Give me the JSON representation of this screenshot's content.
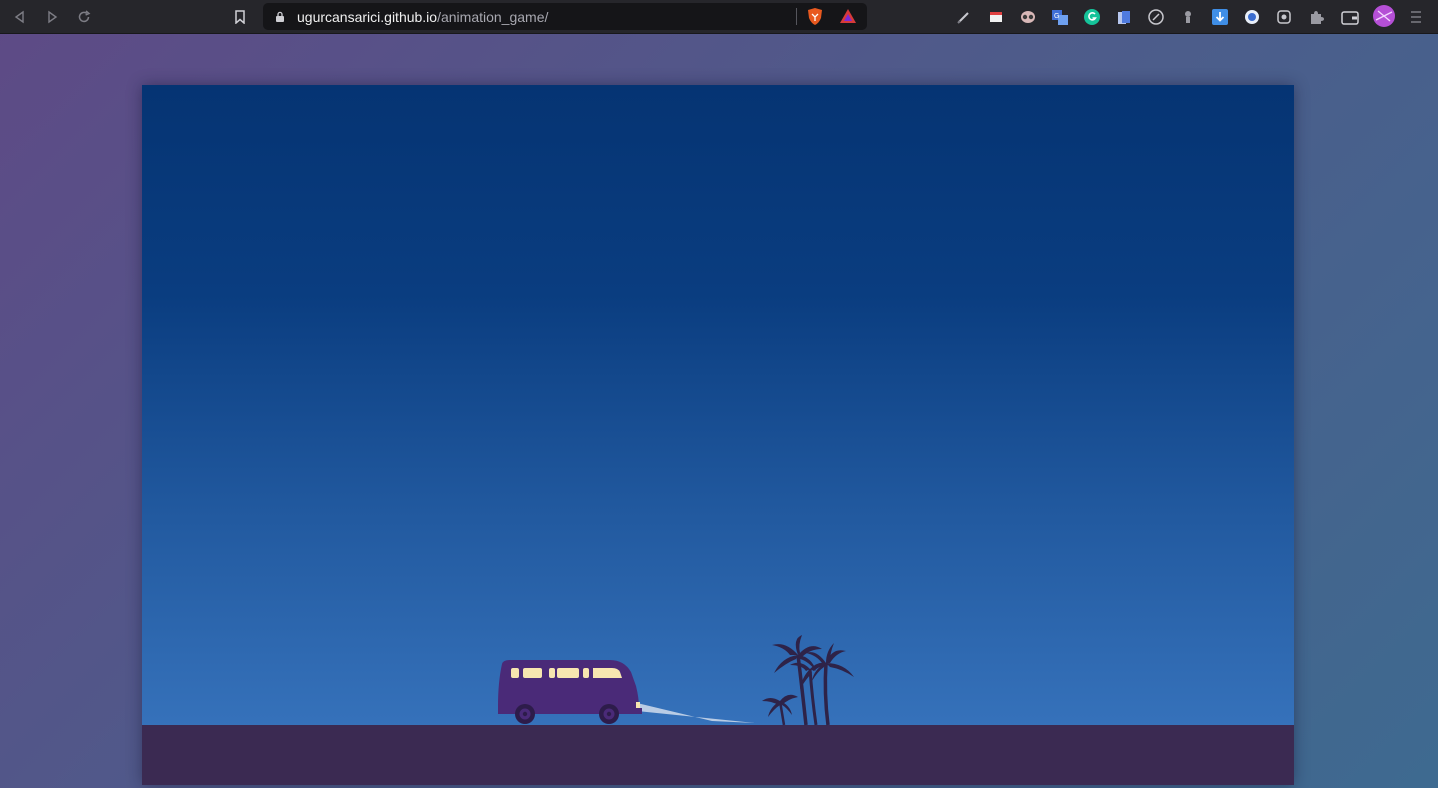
{
  "browser": {
    "url_host": "ugurcansarici.github.io",
    "url_path": "/animation_game/",
    "extensions": [
      "pen-icon",
      "note-icon",
      "owl-icon",
      "translate-icon",
      "grammarly-icon",
      "bookmark-tabs-icon",
      "compass-icon",
      "lamp-icon",
      "download-arrow-icon",
      "circle-logo-icon",
      "camera-icon",
      "puzzle-icon",
      "wallet-icon",
      "profile-avatar",
      "menu-icon"
    ]
  },
  "scene": {
    "elements": [
      "night-sky",
      "ground",
      "purple-van",
      "headlight-beam",
      "palm-trees"
    ],
    "colors": {
      "sky_top": "#053473",
      "sky_bottom": "#3a78c0",
      "ground": "#3b2a52",
      "van": "#4a2a78",
      "van_windows": "#f7e6b0",
      "palm": "#2e2348"
    }
  }
}
